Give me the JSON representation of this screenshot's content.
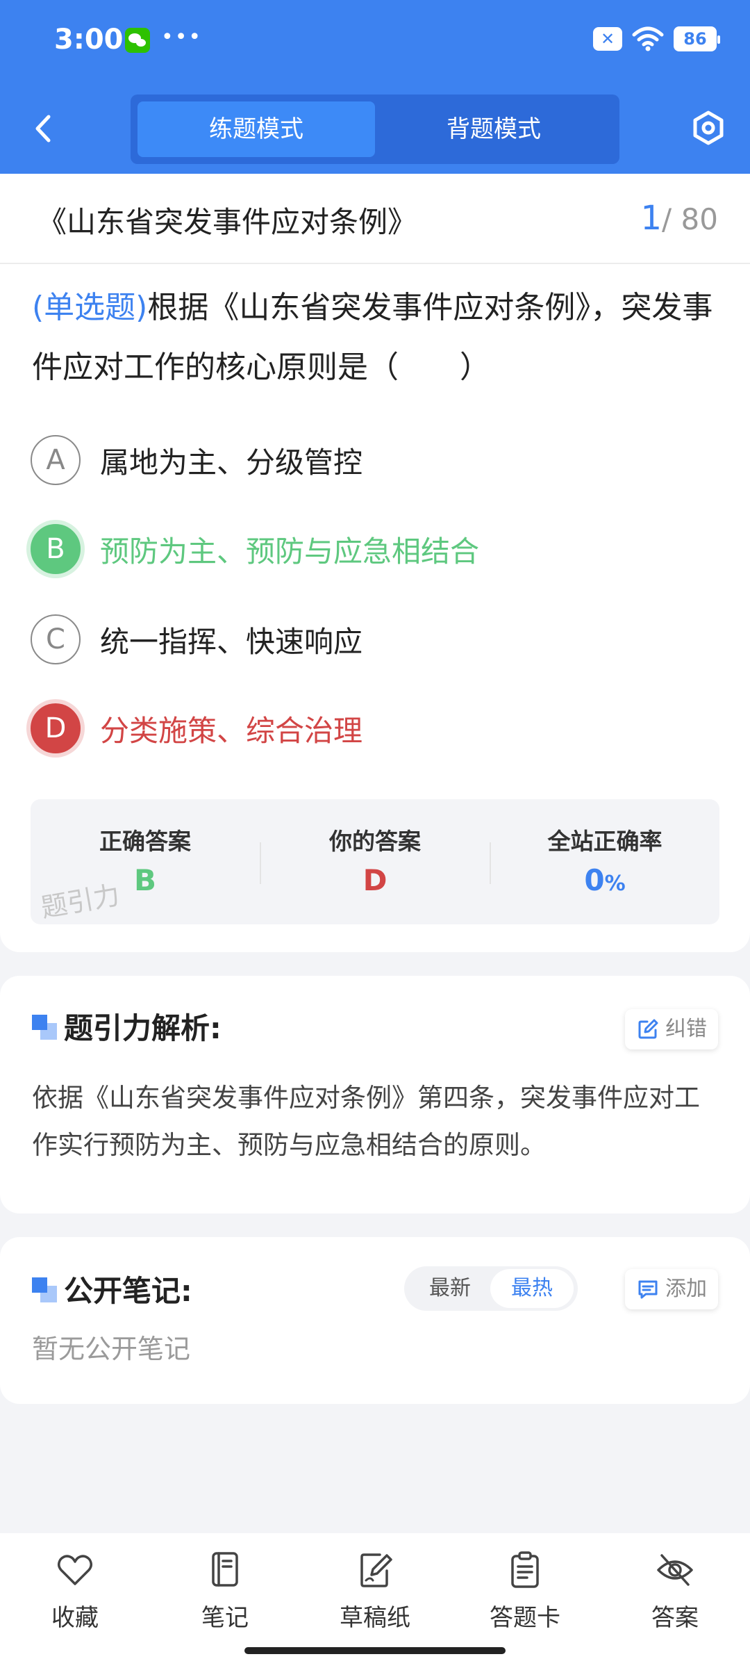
{
  "status_bar": {
    "time": "3:00",
    "battery": "86"
  },
  "header": {
    "mode_tabs": [
      {
        "label": "练题模式",
        "active": true
      },
      {
        "label": "背题模式",
        "active": false
      }
    ]
  },
  "exam": {
    "title": "《山东省突发事件应对条例》",
    "current_index": "1",
    "total": "/ 80"
  },
  "question": {
    "type_label": "(单选题)",
    "text": "根据《山东省突发事件应对条例》，突发事件应对工作的核心原则是（　　）"
  },
  "options": [
    {
      "letter": "A",
      "text": "属地为主、分级管控",
      "state": "default"
    },
    {
      "letter": "B",
      "text": "预防为主、预防与应急相结合",
      "state": "correct"
    },
    {
      "letter": "C",
      "text": "统一指挥、快速响应",
      "state": "default"
    },
    {
      "letter": "D",
      "text": "分类施策、综合治理",
      "state": "wrong"
    }
  ],
  "result": {
    "correct_label": "正确答案",
    "correct_value": "B",
    "yours_label": "你的答案",
    "yours_value": "D",
    "rate_label": "全站正确率",
    "rate_value": "0",
    "rate_unit": "%",
    "watermark": "题引力"
  },
  "analysis": {
    "title": "题引力解析:",
    "report_button": "纠错",
    "text": "依据《山东省突发事件应对条例》第四条，突发事件应对工作实行预防为主、预防与应急相结合的原则。"
  },
  "notes": {
    "title": "公开笔记:",
    "sort_options": [
      "最新",
      "最热"
    ],
    "selected_sort": "最热",
    "add_button": "添加",
    "empty_text": "暂无公开笔记"
  },
  "bottom_tabs": [
    {
      "label": "收藏",
      "icon": "heart-icon"
    },
    {
      "label": "笔记",
      "icon": "notebook-icon"
    },
    {
      "label": "草稿纸",
      "icon": "draft-icon"
    },
    {
      "label": "答题卡",
      "icon": "clipboard-icon"
    },
    {
      "label": "答案",
      "icon": "eye-off-icon"
    }
  ],
  "colors": {
    "primary": "#3d82f0",
    "correct": "#5ec87f",
    "wrong": "#d24545"
  }
}
